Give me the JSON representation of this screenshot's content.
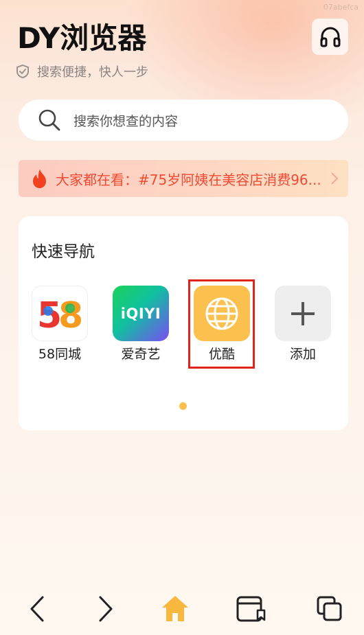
{
  "watermark": "07abefca",
  "header": {
    "app_title": "DY浏览器",
    "slogan": "搜索便捷，快人一步",
    "headset_icon": "headphones-icon",
    "shield_icon": "shield-check-icon"
  },
  "search": {
    "placeholder": "搜索你想查的内容",
    "icon": "search-icon"
  },
  "trending": {
    "text": "大家都在看：#75岁阿姨在美容店消费96...",
    "icon": "flame-icon",
    "color": "#f04a32"
  },
  "quick_nav": {
    "title": "快速导航",
    "tiles": [
      {
        "label": "58同城",
        "icon": "58tongcheng-logo-icon"
      },
      {
        "label": "爱奇艺",
        "icon": "iqiyi-logo-icon",
        "logo_text": "iQIYI"
      },
      {
        "label": "优酷",
        "icon": "globe-icon"
      },
      {
        "label": "添加",
        "icon": "plus-icon"
      }
    ],
    "page_indicator": {
      "current": 1,
      "total": 1
    }
  },
  "bottom_nav": {
    "items": [
      {
        "name": "back",
        "icon": "chevron-left-icon"
      },
      {
        "name": "forward",
        "icon": "chevron-right-icon"
      },
      {
        "name": "home",
        "icon": "home-icon",
        "active": true
      },
      {
        "name": "bookmarks",
        "icon": "bookmark-box-icon"
      },
      {
        "name": "tabs",
        "icon": "tabs-icon"
      }
    ]
  },
  "colors": {
    "accent": "#fbc04e",
    "highlight": "#e1231e",
    "home_active": "#f8b73e"
  }
}
